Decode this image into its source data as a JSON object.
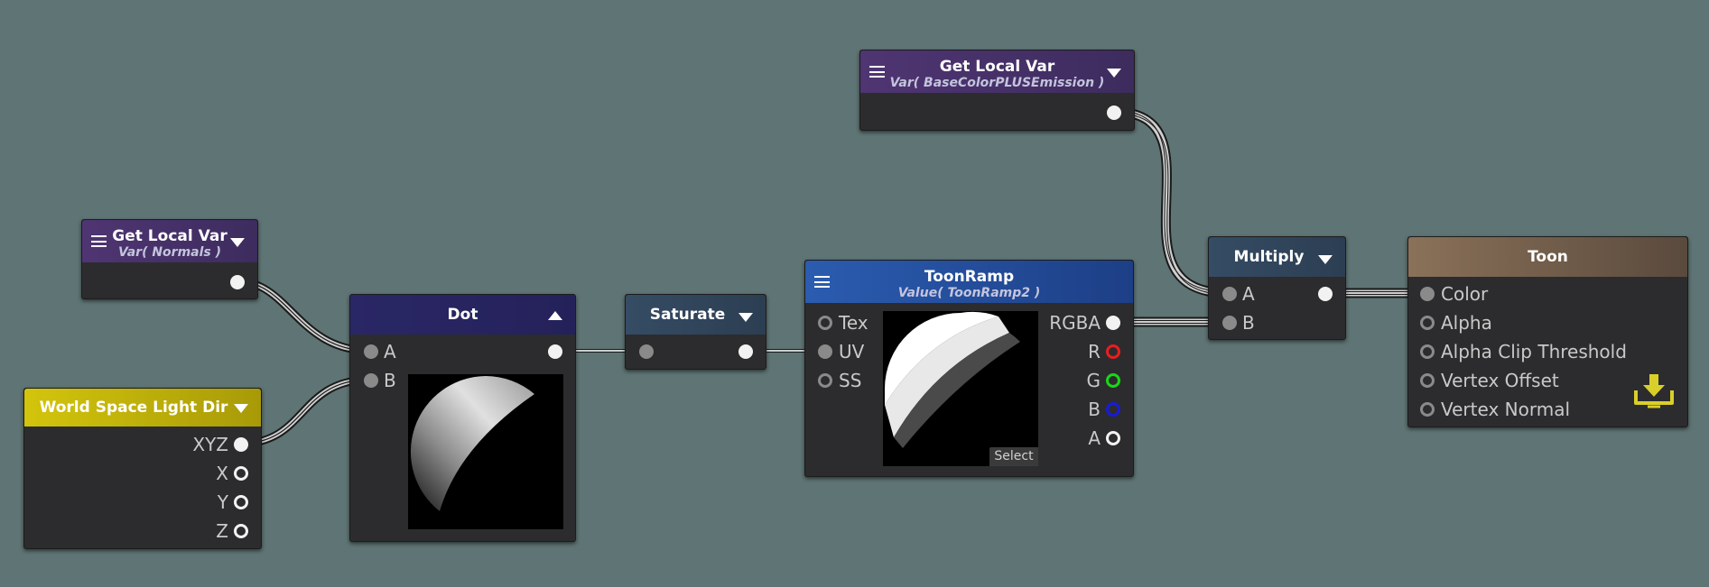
{
  "colors": {
    "background": "#5f7474",
    "node_body": "#2c2c2e",
    "local_var_header": "#4f3572",
    "dot_header": "#2a2766",
    "saturate_header": "#354c64",
    "toonramp_header": "#2b5cb0",
    "light_dir_header": "#d3c50c",
    "toon_header": "#8a7159",
    "port_r": "#e81e1e",
    "port_g": "#18d818",
    "port_b": "#1a1ad8",
    "output_icon": "#d9cf2a"
  },
  "nodes": {
    "get_local_var_normals": {
      "title": "Get Local Var",
      "subtitle": "Var( Normals )"
    },
    "get_local_var_basecolor": {
      "title": "Get Local Var",
      "subtitle": "Var( BaseColorPLUSEmission )"
    },
    "world_space_light_dir": {
      "title": "World Space Light Dir",
      "outputs": [
        "XYZ",
        "X",
        "Y",
        "Z"
      ]
    },
    "dot": {
      "title": "Dot",
      "inputs": [
        "A",
        "B"
      ]
    },
    "saturate": {
      "title": "Saturate"
    },
    "toonramp": {
      "title": "ToonRamp",
      "subtitle": "Value( ToonRamp2 )",
      "inputs": [
        "Tex",
        "UV",
        "SS"
      ],
      "outputs": [
        "RGBA",
        "R",
        "G",
        "B",
        "A"
      ],
      "select_label": "Select"
    },
    "multiply": {
      "title": "Multiply",
      "inputs": [
        "A",
        "B"
      ]
    },
    "toon": {
      "title": "Toon",
      "inputs": [
        "Color",
        "Alpha",
        "Alpha Clip Threshold",
        "Vertex Offset",
        "Vertex Normal"
      ]
    }
  },
  "icons": {
    "menu": "hamburger-menu-icon",
    "collapse": "triangle-down-icon",
    "expand": "triangle-up-icon",
    "master_output": "download-tray-icon"
  }
}
